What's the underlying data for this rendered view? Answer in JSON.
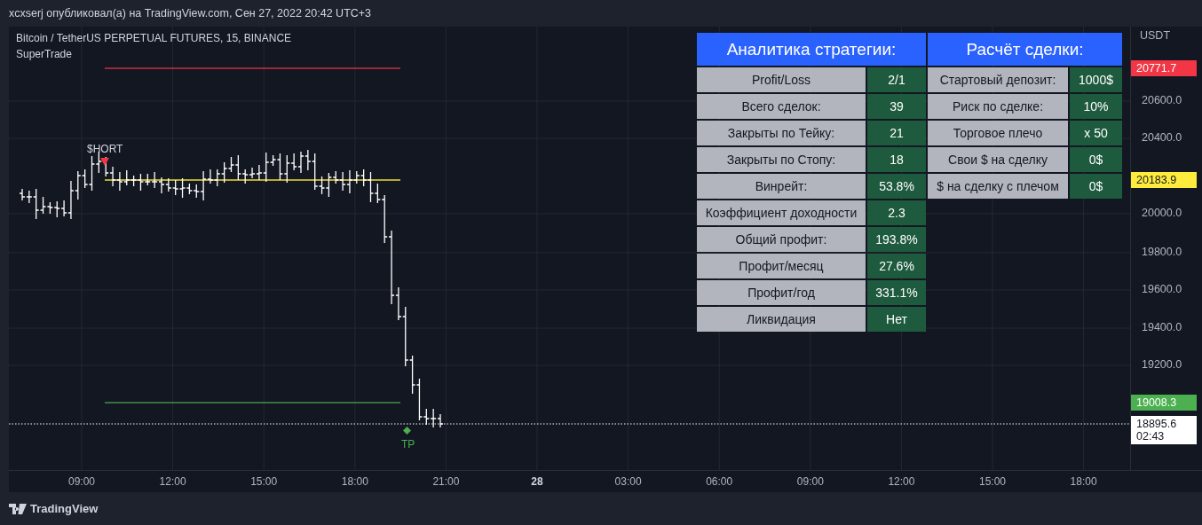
{
  "header": {
    "title": "xcxserj опубликовал(а) на TradingView.com, Сен 27, 2022 20:42 UTC+3"
  },
  "legend": {
    "symbol": "Bitcoin / TetherUS PERPETUAL FUTURES, 15, BINANCE",
    "indicator": "SuperTrade"
  },
  "markers": [
    {
      "kind": "entry",
      "label": "$HORT",
      "color": "#f23645"
    },
    {
      "kind": "exit",
      "label": "TP",
      "color": "#4caf50"
    }
  ],
  "price_axis": {
    "currency": "USDT",
    "ticks": [
      "20600.0",
      "20400.0",
      "20000.0",
      "19800.0",
      "19600.0",
      "19400.0",
      "19200.0"
    ],
    "tags": [
      {
        "kind": "level",
        "text": "20771.7",
        "color": "#f23645"
      },
      {
        "kind": "level",
        "text": "20183.9",
        "color": "#ffeb3b"
      },
      {
        "kind": "level",
        "text": "19008.3",
        "color": "#4caf50"
      },
      {
        "kind": "current",
        "text": "18895.6",
        "countdown": "02:43",
        "color": "#ffffff"
      }
    ]
  },
  "time_axis": [
    {
      "label": "09:00",
      "kind": "time"
    },
    {
      "label": "12:00",
      "kind": "time"
    },
    {
      "label": "15:00",
      "kind": "time"
    },
    {
      "label": "18:00",
      "kind": "time"
    },
    {
      "label": "21:00",
      "kind": "time"
    },
    {
      "label": "28",
      "kind": "day"
    },
    {
      "label": "03:00",
      "kind": "time"
    },
    {
      "label": "06:00",
      "kind": "time"
    },
    {
      "label": "09:00",
      "kind": "time"
    },
    {
      "label": "12:00",
      "kind": "time"
    },
    {
      "label": "15:00",
      "kind": "time"
    },
    {
      "label": "18:00",
      "kind": "time"
    }
  ],
  "analytics_table": {
    "title": "Аналитика стратегии:",
    "rows": [
      {
        "label": "Profit/Loss",
        "value": "2/1"
      },
      {
        "label": "Всего сделок:",
        "value": "39"
      },
      {
        "label": "Закрыты по Тейку:",
        "value": "21"
      },
      {
        "label": "Закрыты по Стопу:",
        "value": "18"
      },
      {
        "label": "Винрейт:",
        "value": "53.8%"
      },
      {
        "label": "Коэффициент доходности",
        "value": "2.3"
      },
      {
        "label": "Общий профит:",
        "value": "193.8%"
      },
      {
        "label": "Профит/месяц",
        "value": "27.6%"
      },
      {
        "label": "Профит/год",
        "value": "331.1%"
      },
      {
        "label": "Ликвидация",
        "value": "Нет"
      }
    ]
  },
  "trade_table": {
    "title": "Расчёт сделки:",
    "rows": [
      {
        "label": "Стартовый депозит:",
        "value": "1000$"
      },
      {
        "label": "Риск по сделке:",
        "value": "10%"
      },
      {
        "label": "Торговое плечо",
        "value": "x 50"
      },
      {
        "label": "Свои $ на сделку",
        "value": "0$"
      },
      {
        "label": "$ на сделку с плечом",
        "value": "0$"
      }
    ]
  },
  "footer": {
    "brand": "TradingView"
  }
}
